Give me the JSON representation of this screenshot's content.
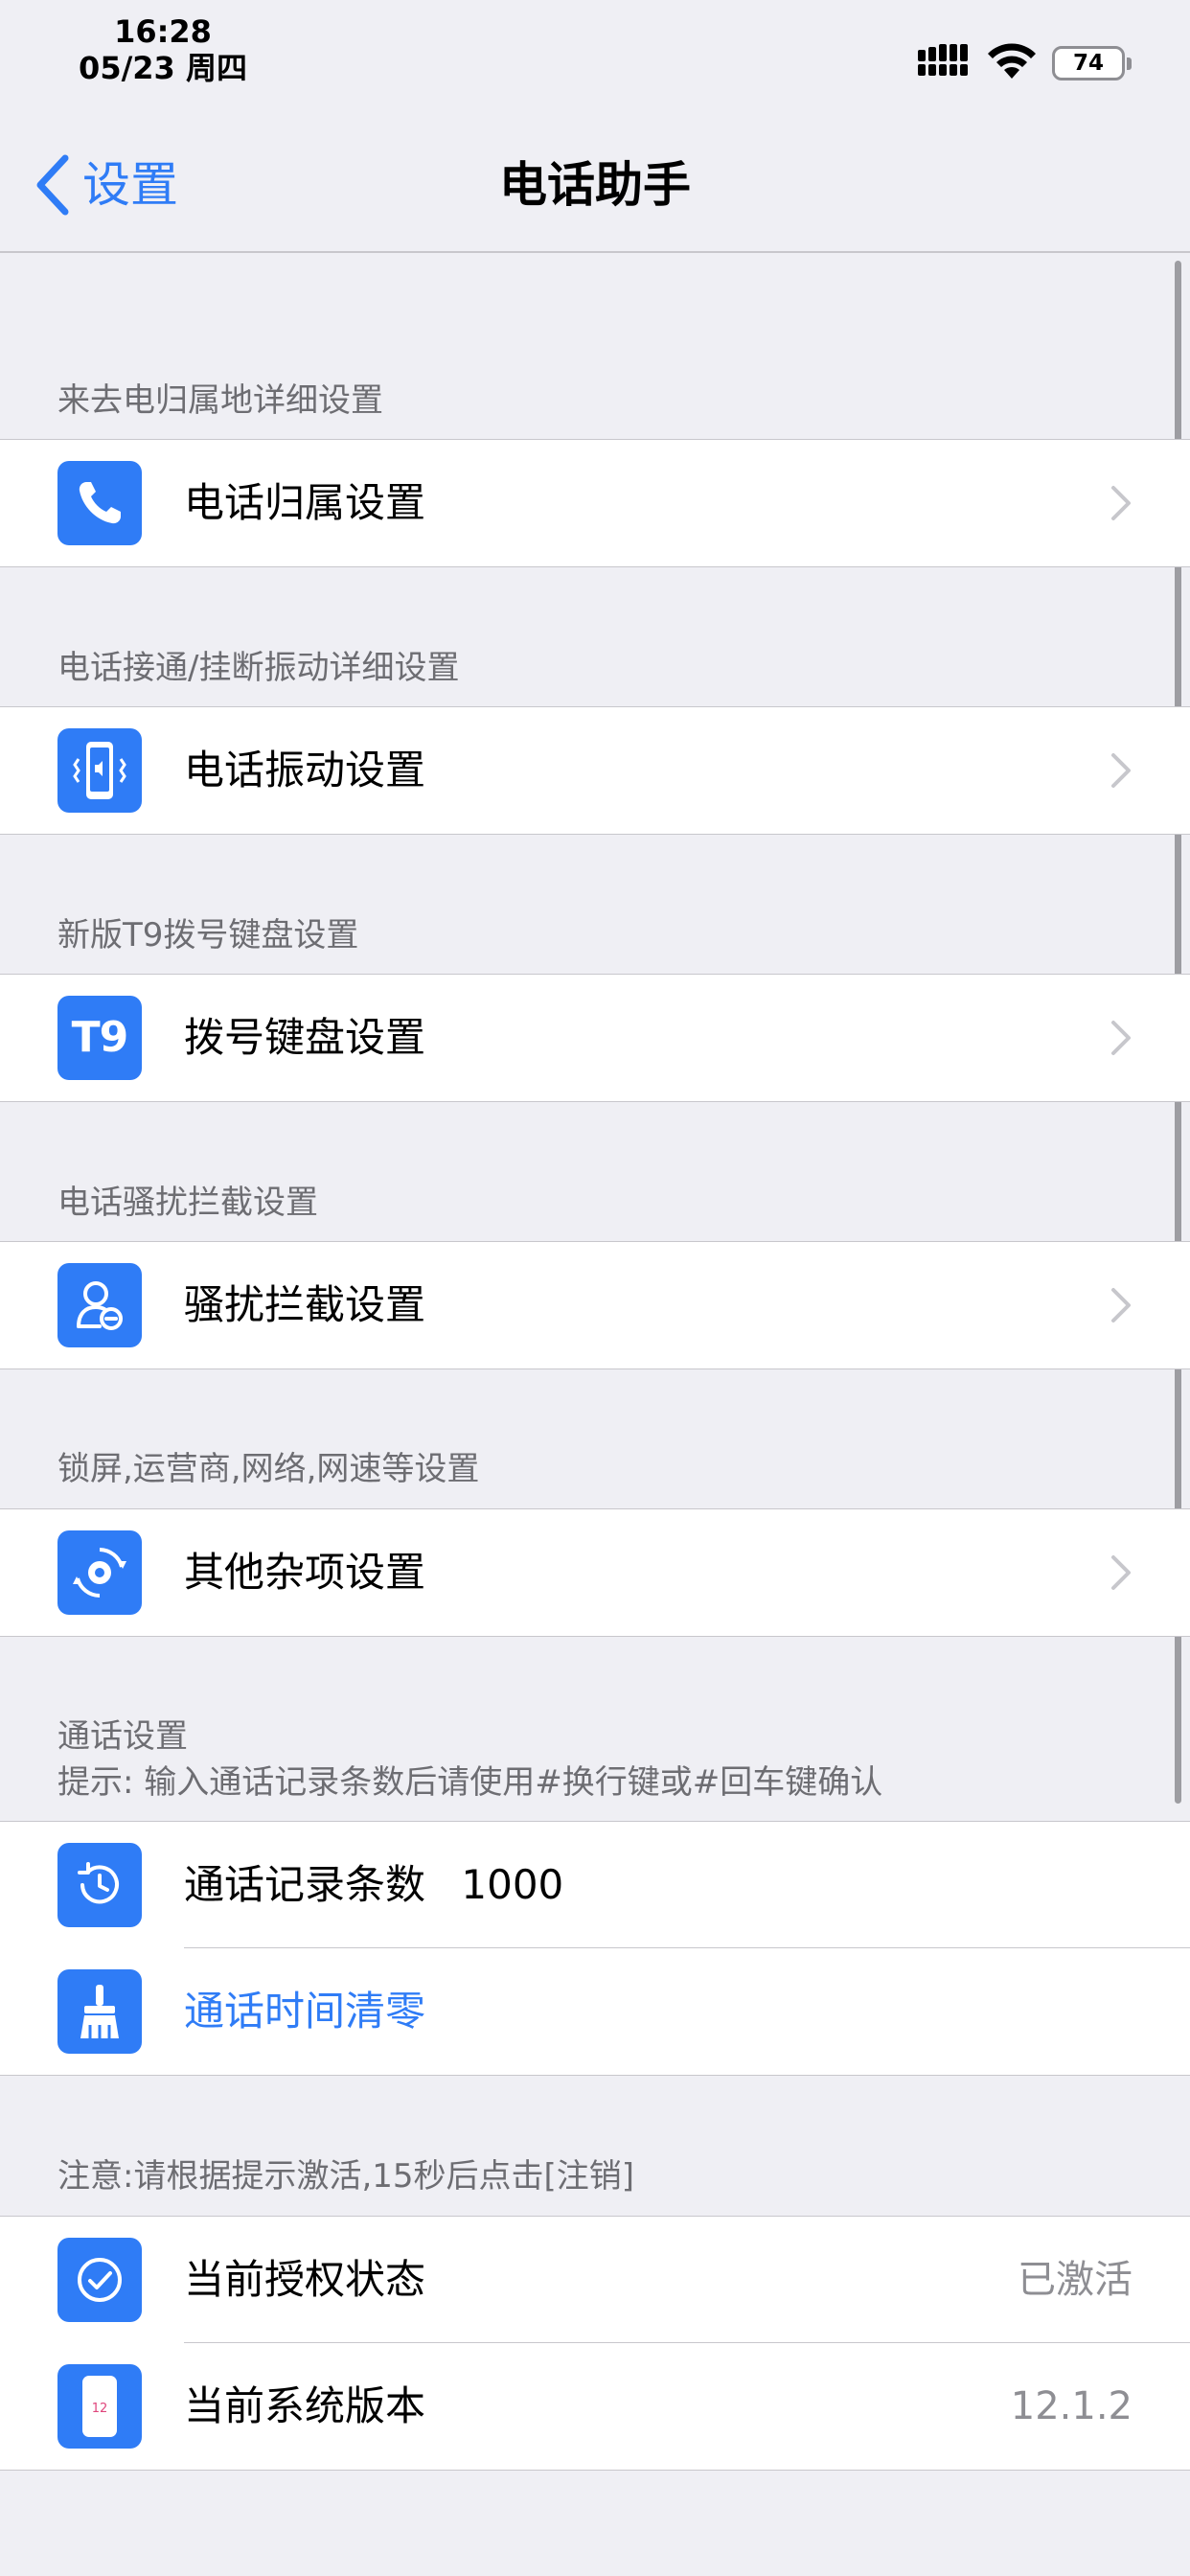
{
  "status_bar": {
    "time": "16:28",
    "date": "05/23 周四",
    "battery": "74"
  },
  "nav": {
    "back_label": "设置",
    "title": "电话助手"
  },
  "sections": {
    "location": {
      "header": "来去电归属地详细设置",
      "item": "电话归属设置",
      "icon": "phone-icon"
    },
    "vibration": {
      "header": "电话接通/挂断振动详细设置",
      "item": "电话振动设置",
      "icon": "phone-vibrate-icon"
    },
    "keypad": {
      "header": "新版T9拨号键盘设置",
      "item": "拨号键盘设置",
      "icon_text": "T9"
    },
    "block": {
      "header": "电话骚扰拦截设置",
      "item": "骚扰拦截设置",
      "icon": "user-block-icon"
    },
    "misc": {
      "header": "锁屏,运营商,网络,网速等设置",
      "item": "其他杂项设置",
      "icon": "gear-sync-icon"
    },
    "call": {
      "header": "通话设置",
      "hint": "提示: 输入通话记录条数后请使用#换行键或#回车键确认",
      "records_label": "通话记录条数",
      "records_value": "1000",
      "clear_label": "通话时间清零"
    },
    "auth": {
      "header": "注意:请根据提示激活,15秒后点击[注销]",
      "status_label": "当前授权状态",
      "status_value": "已激活",
      "version_label": "当前系统版本",
      "version_value": "12.1.2",
      "version_icon_text": "12"
    }
  },
  "colors": {
    "accent": "#2f7cf6",
    "background": "#efeff4",
    "secondary_text": "#6d6d72",
    "value_text": "#8e8e93"
  }
}
